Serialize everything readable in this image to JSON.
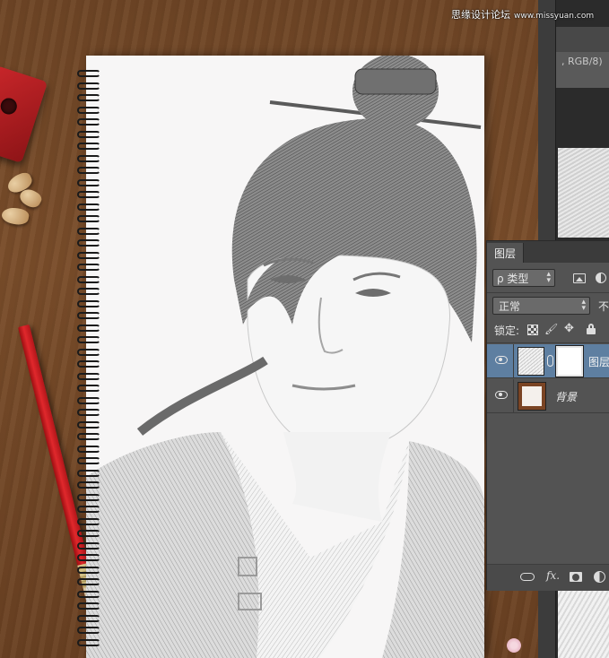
{
  "watermark": {
    "site_name": "思缘设计论坛",
    "site_url": "www.missyuan.com"
  },
  "document": {
    "title_fragment": ", RGB/8)"
  },
  "layers_panel": {
    "tab_label": "图层",
    "filter": {
      "selected": "ρ 类型",
      "image_filter_icon": "image-icon",
      "adjustment_filter_icon": "adjustment-icon"
    },
    "blend_mode": {
      "selected": "正常"
    },
    "opacity_label": "不",
    "lock": {
      "label": "锁定:",
      "icons": [
        "lock-transparent-icon",
        "brush-icon",
        "move-icon",
        "lock-icon"
      ]
    },
    "layers": [
      {
        "name": "图层",
        "selected": true,
        "visible": true,
        "has_mask": true
      },
      {
        "name": "背景",
        "selected": false,
        "visible": true,
        "has_mask": false
      }
    ],
    "footer_icons": [
      "link-icon",
      "fx-icon",
      "mask-icon",
      "adjustment-icon"
    ],
    "footer_fx_label": "fx."
  },
  "colors": {
    "selected_layer_row": "#5e7fa1",
    "panel_bg": "#535353",
    "desk_wood": "#7a4d2a",
    "pencil_red": "#e0282c"
  }
}
